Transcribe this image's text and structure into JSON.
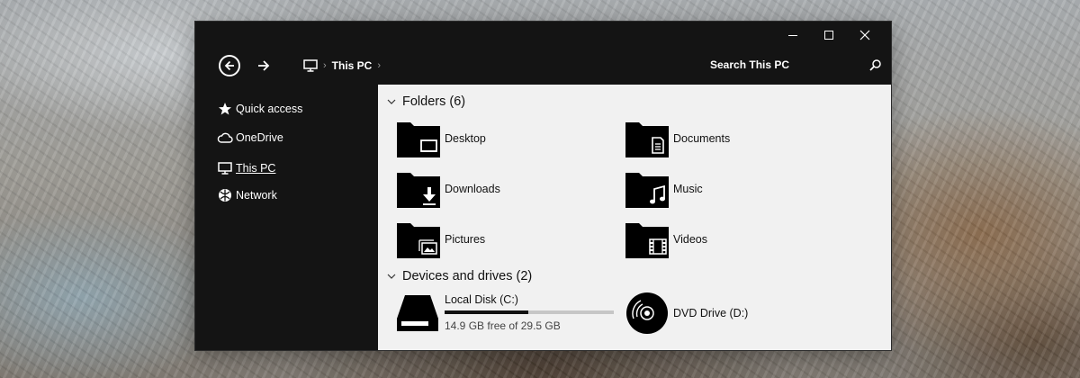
{
  "window": {
    "controls": {
      "minimize": "minimize-icon",
      "maximize": "maximize-icon",
      "close": "close-icon"
    }
  },
  "nav": {
    "back_icon": "back-arrow-icon",
    "forward_icon": "forward-arrow-icon",
    "breadcrumb": {
      "icon": "computer-icon",
      "location": "This PC"
    },
    "search_placeholder": "Search This PC"
  },
  "sidebar": {
    "items": [
      {
        "label": "Quick access",
        "icon": "star-icon"
      },
      {
        "label": "OneDrive",
        "icon": "cloud-icon"
      },
      {
        "label": "This PC",
        "icon": "computer-icon",
        "active": true
      },
      {
        "label": "Network",
        "icon": "network-icon"
      }
    ]
  },
  "content": {
    "folders_header": "Folders (6)",
    "folders": [
      {
        "name": "Desktop",
        "icon": "desktop-folder-icon"
      },
      {
        "name": "Documents",
        "icon": "documents-folder-icon"
      },
      {
        "name": "Downloads",
        "icon": "downloads-folder-icon"
      },
      {
        "name": "Music",
        "icon": "music-folder-icon"
      },
      {
        "name": "Pictures",
        "icon": "pictures-folder-icon"
      },
      {
        "name": "Videos",
        "icon": "videos-folder-icon"
      }
    ],
    "devices_header": "Devices and drives (2)",
    "drives": {
      "local": {
        "name": "Local Disk (C:)",
        "free_text": "14.9 GB free of 29.5 GB",
        "used_fraction": 0.495
      },
      "dvd": {
        "name": "DVD Drive (D:)"
      }
    }
  },
  "colors": {
    "window_bg": "#141414",
    "content_bg": "#f1f1f1",
    "text_light": "#ffffff"
  }
}
